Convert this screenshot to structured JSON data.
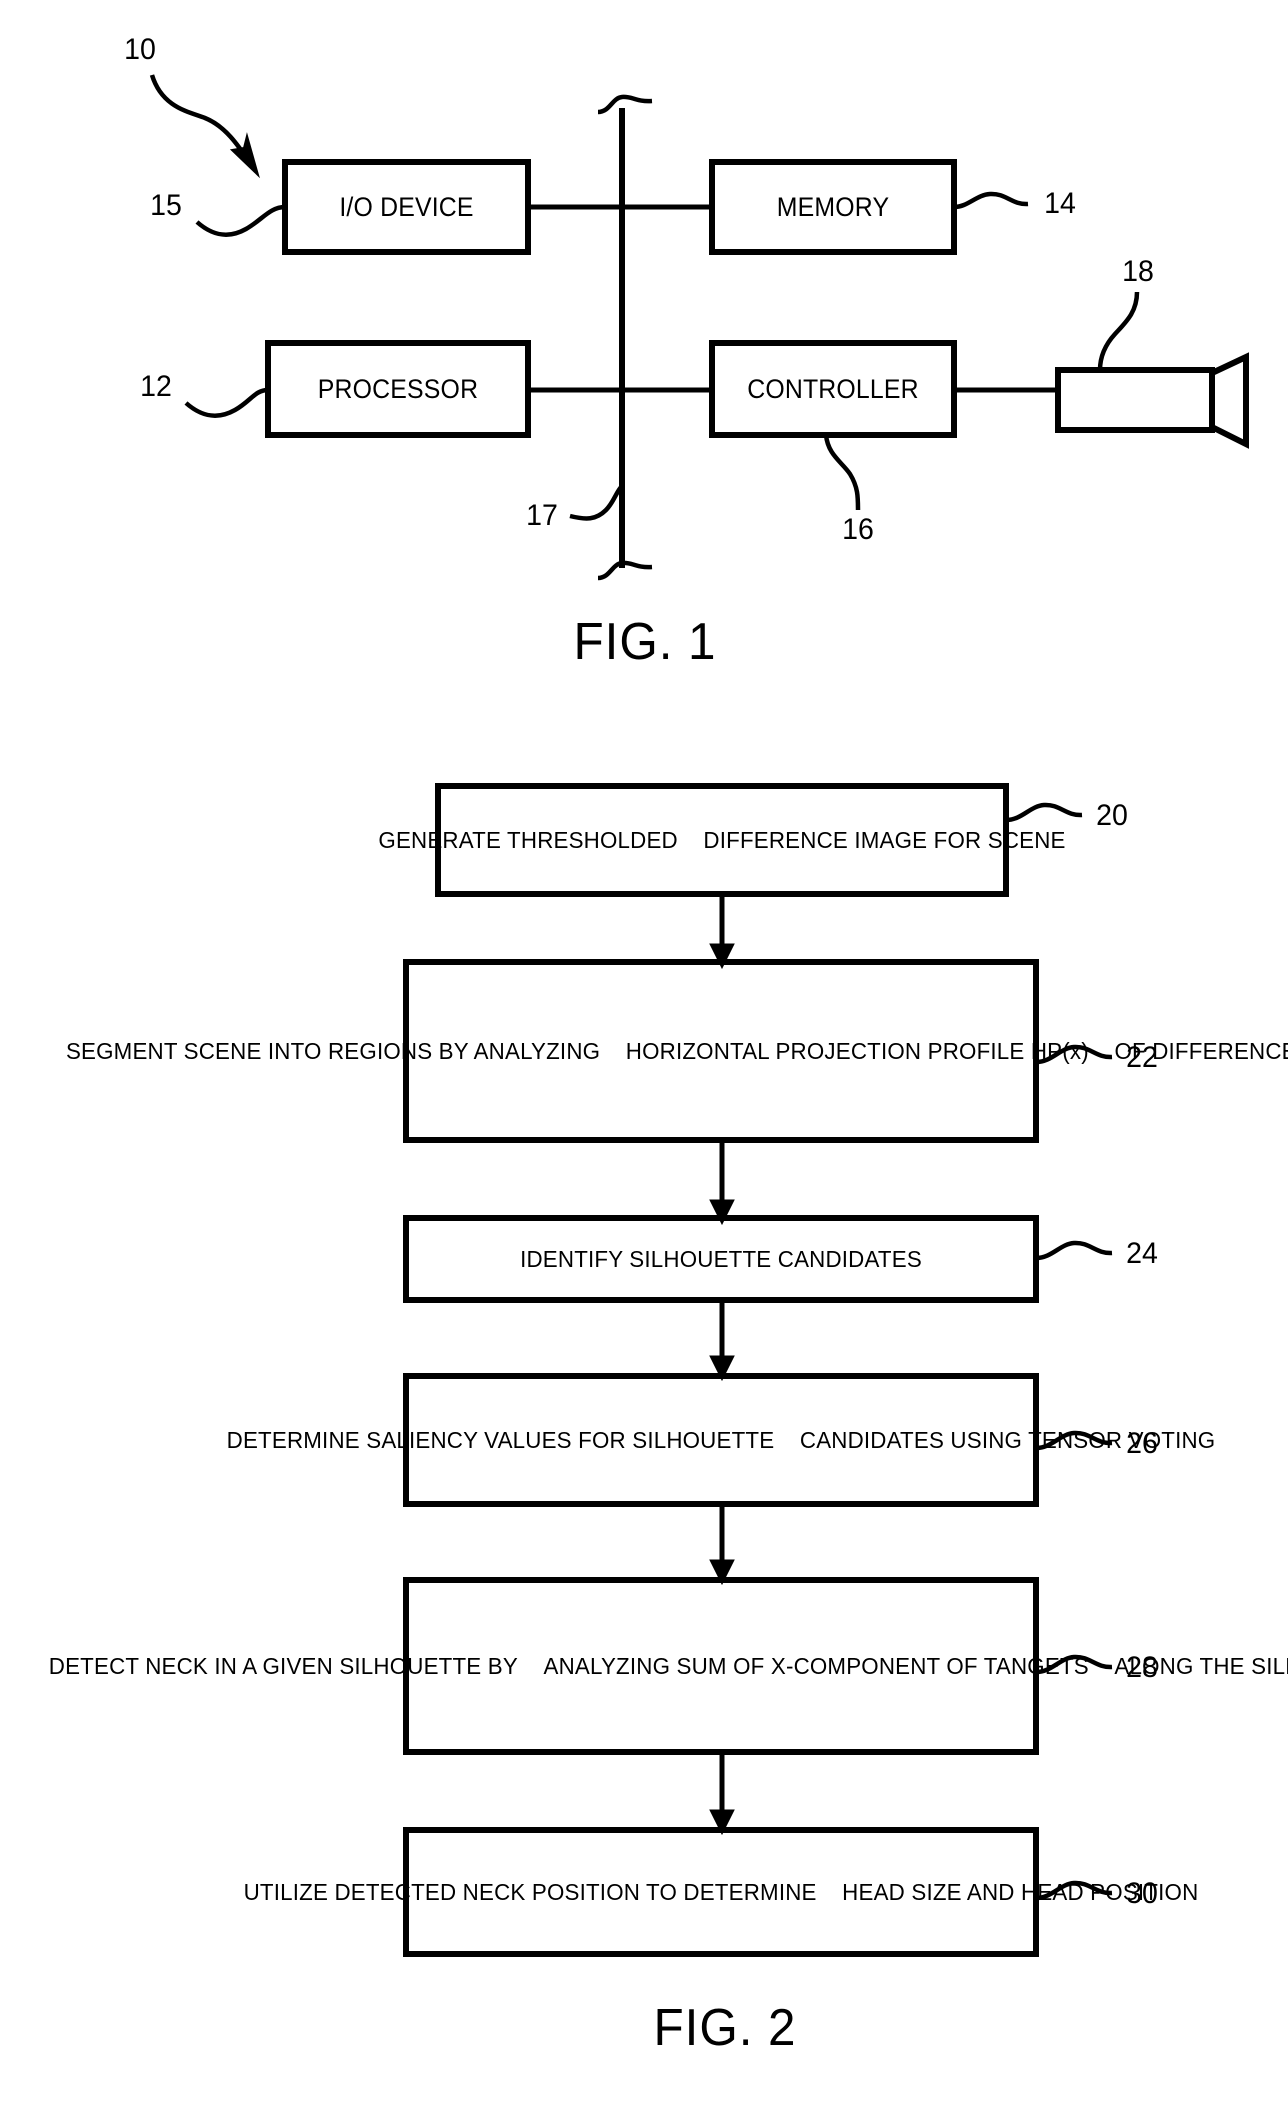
{
  "figures": [
    {
      "id": "fig1",
      "caption": "FIG. 1",
      "system_ref": "10",
      "blocks": [
        {
          "label": "I/O DEVICE",
          "ref": "15"
        },
        {
          "label": "MEMORY",
          "ref": "14"
        },
        {
          "label": "PROCESSOR",
          "ref": "12"
        },
        {
          "label": "CONTROLLER",
          "ref": "16"
        }
      ],
      "bus_ref": "17",
      "camera_ref": "18",
      "camera_name": "camera"
    },
    {
      "id": "fig2",
      "caption": "FIG. 2",
      "steps": [
        {
          "ref": "20",
          "lines": [
            "GENERATE THRESHOLDED",
            "DIFFERENCE IMAGE FOR SCENE"
          ]
        },
        {
          "ref": "22",
          "lines": [
            "SEGMENT SCENE INTO REGIONS BY ANALYZING",
            "HORIZONTAL PROJECTION PROFILE HP(x)",
            "OF DIFFERENCE IMAGE"
          ]
        },
        {
          "ref": "24",
          "lines": [
            "IDENTIFY SILHOUETTE CANDIDATES"
          ]
        },
        {
          "ref": "26",
          "lines": [
            "DETERMINE SALIENCY VALUES FOR SILHOUETTE",
            "CANDIDATES USING TENSOR VOTING"
          ]
        },
        {
          "ref": "28",
          "lines": [
            "DETECT NECK IN A GIVEN SILHOUETTE BY",
            "ANALYZING SUM OF X-COMPONENT OF TANGETS",
            "ALONG THE SILHOUETTE"
          ]
        },
        {
          "ref": "30",
          "lines": [
            "UTILIZE DETECTED NECK POSITION TO DETERMINE",
            "HEAD SIZE AND HEAD POSITION"
          ]
        }
      ]
    }
  ],
  "colors": {
    "ink": "#000000",
    "paper": "#ffffff"
  }
}
